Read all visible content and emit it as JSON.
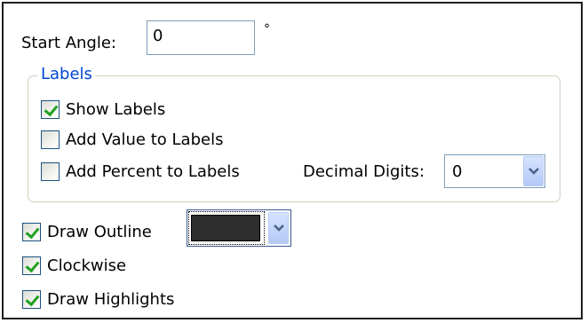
{
  "start_angle": {
    "label": "Start Angle:",
    "value": "0",
    "unit": "°"
  },
  "labels_group": {
    "title": "Labels",
    "show_labels": {
      "label": "Show Labels",
      "checked": true
    },
    "add_value": {
      "label": "Add Value to Labels",
      "checked": false
    },
    "add_percent": {
      "label": "Add Percent to Labels",
      "checked": false
    },
    "decimal_digits": {
      "label": "Decimal Digits:",
      "value": "0"
    }
  },
  "draw_outline": {
    "label": "Draw Outline",
    "checked": true,
    "color": "#2e2e2e"
  },
  "clockwise": {
    "label": "Clockwise",
    "checked": true
  },
  "draw_highlights": {
    "label": "Draw Highlights",
    "checked": true
  },
  "colors": {
    "accent": "#0046d5",
    "check": "#21a121",
    "border": "#7f9db9"
  }
}
